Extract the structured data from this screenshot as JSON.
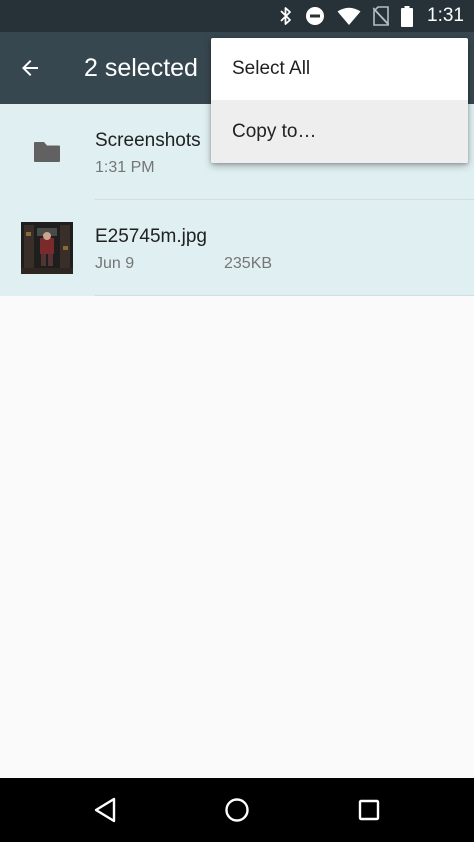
{
  "status_bar": {
    "time": "1:31",
    "icons": [
      "bluetooth-icon",
      "do-not-disturb-icon",
      "wifi-icon",
      "no-sim-icon",
      "battery-icon"
    ]
  },
  "action_bar": {
    "back_icon": "arrow-back-icon",
    "title": "2 selected"
  },
  "overflow_menu": {
    "items": [
      {
        "label": "Select All"
      },
      {
        "label": "Copy to…"
      }
    ]
  },
  "files": [
    {
      "name": "Screenshots",
      "date": "1:31 PM",
      "size": "",
      "type": "folder",
      "selected": true
    },
    {
      "name": "E25745m.jpg",
      "date": "Jun 9",
      "size": "235KB",
      "type": "image",
      "selected": true
    }
  ],
  "nav_bar": {
    "icons": [
      "back-triangle-icon",
      "home-circle-icon",
      "recents-square-icon"
    ]
  },
  "colors": {
    "status_bar": "#263238",
    "action_bar": "#37474f",
    "selected_row": "#e0f0f2",
    "background": "#fafafa"
  }
}
